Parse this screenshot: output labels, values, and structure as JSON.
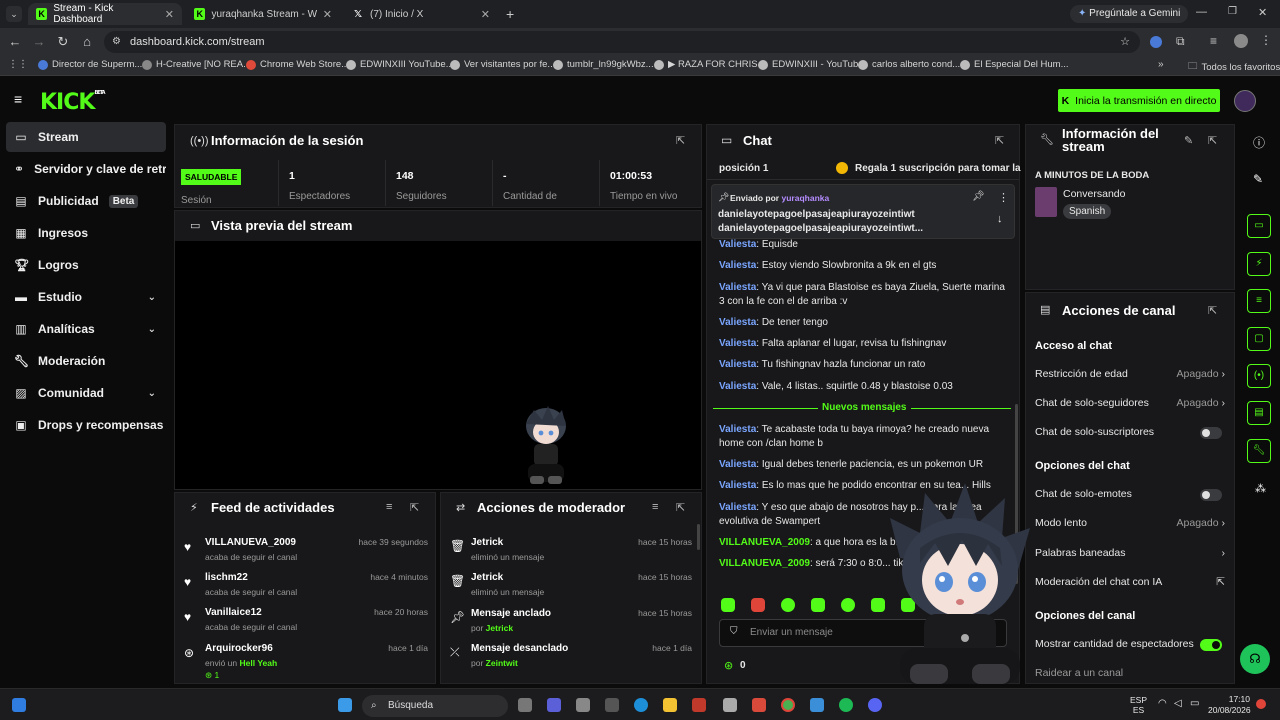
{
  "browser": {
    "tabs": [
      {
        "label": "Stream - Kick Dashboard",
        "icon": "kick-icon"
      },
      {
        "label": "yuraqhanka Stream - Watch Liv",
        "icon": "kick-icon"
      },
      {
        "label": "(7) Inicio / X",
        "icon": "x-icon"
      }
    ],
    "gemini_label": "Pregúntale a Gemini",
    "url": "dashboard.kick.com/stream",
    "bookmarks": [
      "Director de Superm...",
      "H-Creative [NO REA...",
      "Chrome Web Store...",
      "EDWINXIII YouTube...",
      "Ver visitantes por fe...",
      "tumblr_ln99gkWbz...",
      "▶ RAZA FOR CHRIS...",
      "EDWINXIII - YouTube",
      "carlos alberto cond...",
      "El Especial Del Hum..."
    ],
    "all_favorites": "Todos los favoritos"
  },
  "kick": {
    "logo": "KICK",
    "logo_tag": "BETA",
    "go_live": "Inicia la transmisión en directo"
  },
  "sidebar": {
    "items": [
      {
        "label": "Stream",
        "icon": "stream-icon"
      },
      {
        "label": "Servidor y clave de retrans",
        "icon": "link-icon"
      },
      {
        "label": "Publicidad",
        "icon": "ads-icon",
        "badge": "Beta"
      },
      {
        "label": "Ingresos",
        "icon": "income-icon"
      },
      {
        "label": "Logros",
        "icon": "trophy-icon"
      },
      {
        "label": "Estudio",
        "icon": "studio-icon"
      },
      {
        "label": "Analíticas",
        "icon": "analytics-icon"
      },
      {
        "label": "Moderación",
        "icon": "wrench-icon"
      },
      {
        "label": "Comunidad",
        "icon": "community-icon"
      },
      {
        "label": "Drops y recompensas",
        "icon": "gift-icon"
      }
    ]
  },
  "session": {
    "title": "Información de la sesión",
    "status": "SALUDABLE",
    "status_label": "Sesión",
    "stats": [
      {
        "value": "1",
        "label": "Espectadores"
      },
      {
        "value": "148",
        "label": "Seguidores"
      },
      {
        "value": "-",
        "label": "Cantidad de"
      },
      {
        "value": "01:00:53",
        "label": "Tiempo en vivo"
      }
    ]
  },
  "preview": {
    "title": "Vista previa del stream"
  },
  "feed": {
    "title": "Feed de actividades",
    "rows": [
      {
        "name": "VILLANUEVA_2009",
        "sub": "acaba de seguir el canal",
        "time": "hace 39 segundos",
        "icon": "heart-icon"
      },
      {
        "name": "lischm22",
        "sub": "acaba de seguir el canal",
        "time": "hace 4 minutos",
        "icon": "heart-icon"
      },
      {
        "name": "Vanillaice12",
        "sub": "acaba de seguir el canal",
        "time": "hace 20 horas",
        "icon": "heart-icon"
      },
      {
        "name": "Arquirocker96",
        "sub": "envió un",
        "sub_highlight": "Hell Yeah",
        "time": "hace 1 día",
        "icon": "kick-coin-icon",
        "extra": "1"
      }
    ]
  },
  "mod_actions": {
    "title": "Acciones de moderador",
    "rows": [
      {
        "name": "Jetrick",
        "sub": "eliminó un mensaje",
        "time": "hace 15 horas",
        "icon": "trash-icon"
      },
      {
        "name": "Jetrick",
        "sub": "eliminó un mensaje",
        "time": "hace 15 horas",
        "icon": "trash-icon"
      },
      {
        "name": "Mensaje anclado",
        "sub": "por",
        "sub_user": "Jetrick",
        "time": "hace 15 horas",
        "icon": "pin-icon"
      },
      {
        "name": "Mensaje desanclado",
        "sub": "por",
        "sub_user": "Zeintwit",
        "time": "hace 1 día",
        "icon": "unpin-icon"
      }
    ]
  },
  "chat": {
    "title": "Chat",
    "top_position": "posición 1",
    "gift_text": "Regala 1 suscripción para tomar la",
    "pinned_by_prefix": "Enviado por",
    "pinned_by_user": "yuraqhanka",
    "pinned_text_1": "danielayotepagoelpasajeapiurayozeintiwt",
    "pinned_text_2": "danielayotepagoelpasajeapiurayozeintiwt...",
    "messages": [
      {
        "user": "Valiesta",
        "text": ": Equisde"
      },
      {
        "user": "Valiesta",
        "text": ": Estoy viendo Slowbronita a 9k en el gts"
      },
      {
        "user": "Valiesta",
        "text": ": Ya vi que para Blastoise es baya Ziuela, Suerte marina 3 con la fe con el de arriba :v"
      },
      {
        "user": "Valiesta",
        "text": ": De tener tengo"
      },
      {
        "user": "Valiesta",
        "text": ": Falta aplanar el lugar, revisa tu fishingnav"
      },
      {
        "user": "Valiesta",
        "text": ": Tu fishingnav hazla funcionar un rato"
      },
      {
        "user": "Valiesta",
        "text": ": Vale, 4 listas.. squirtle 0.48 y blastoise 0.03"
      }
    ],
    "new_messages": "Nuevos mensajes",
    "messages_new": [
      {
        "user": "Valiesta",
        "text": ": Te acabaste toda tu baya rimoya? he creado nueva home con /clan home b"
      },
      {
        "user": "Valiesta",
        "text": ": Igual debes tenerle paciencia, es un pokemon UR"
      },
      {
        "user": "Valiesta",
        "text": ": Es lo mas que he podido encontrar en su tea... Hills"
      },
      {
        "user": "Valiesta",
        "text": ": Y eso que abajo de nosotros hay p... para la linea evolutiva de Swampert"
      },
      {
        "user": "VILLANUEVA_2009",
        "text": ": a que hora es la b..."
      },
      {
        "user": "VILLANUEVA_2009",
        "text": ": será 7:30 o 8:0... tiktok"
      }
    ],
    "input_placeholder": "Enviar un mensaje",
    "coins": "0"
  },
  "stream_info": {
    "title": "Información del stream",
    "stream_title": "A MINUTOS DE LA BODA",
    "category": "Conversando",
    "language": "Spanish"
  },
  "channel_actions": {
    "title": "Acciones de canal",
    "chat_access": "Acceso al chat",
    "age": {
      "label": "Restricción de edad",
      "value": "Apagado"
    },
    "followers_only": {
      "label": "Chat de solo-seguidores",
      "value": "Apagado"
    },
    "subs_only": {
      "label": "Chat de solo-suscriptores"
    },
    "chat_options": "Opciones del chat",
    "emotes_only": {
      "label": "Chat de solo-emotes"
    },
    "slow_mode": {
      "label": "Modo lento",
      "value": "Apagado"
    },
    "banned_words": {
      "label": "Palabras baneadas"
    },
    "ai_mod": {
      "label": "Moderación del chat con IA"
    },
    "channel_options": "Opciones del canal",
    "show_viewers": {
      "label": "Mostrar cantidad de espectadores"
    },
    "raid": {
      "label": "Raidear a un canal"
    }
  },
  "taskbar": {
    "search": "Búsqueda",
    "lang": "ESP",
    "lang2": "ES",
    "time": "17:10",
    "date": "20/08/2026"
  },
  "colors": {
    "accent": "#53fc18",
    "bg": "#0b0b0c",
    "panel": "#18181a",
    "username": "#7aa6ff"
  }
}
